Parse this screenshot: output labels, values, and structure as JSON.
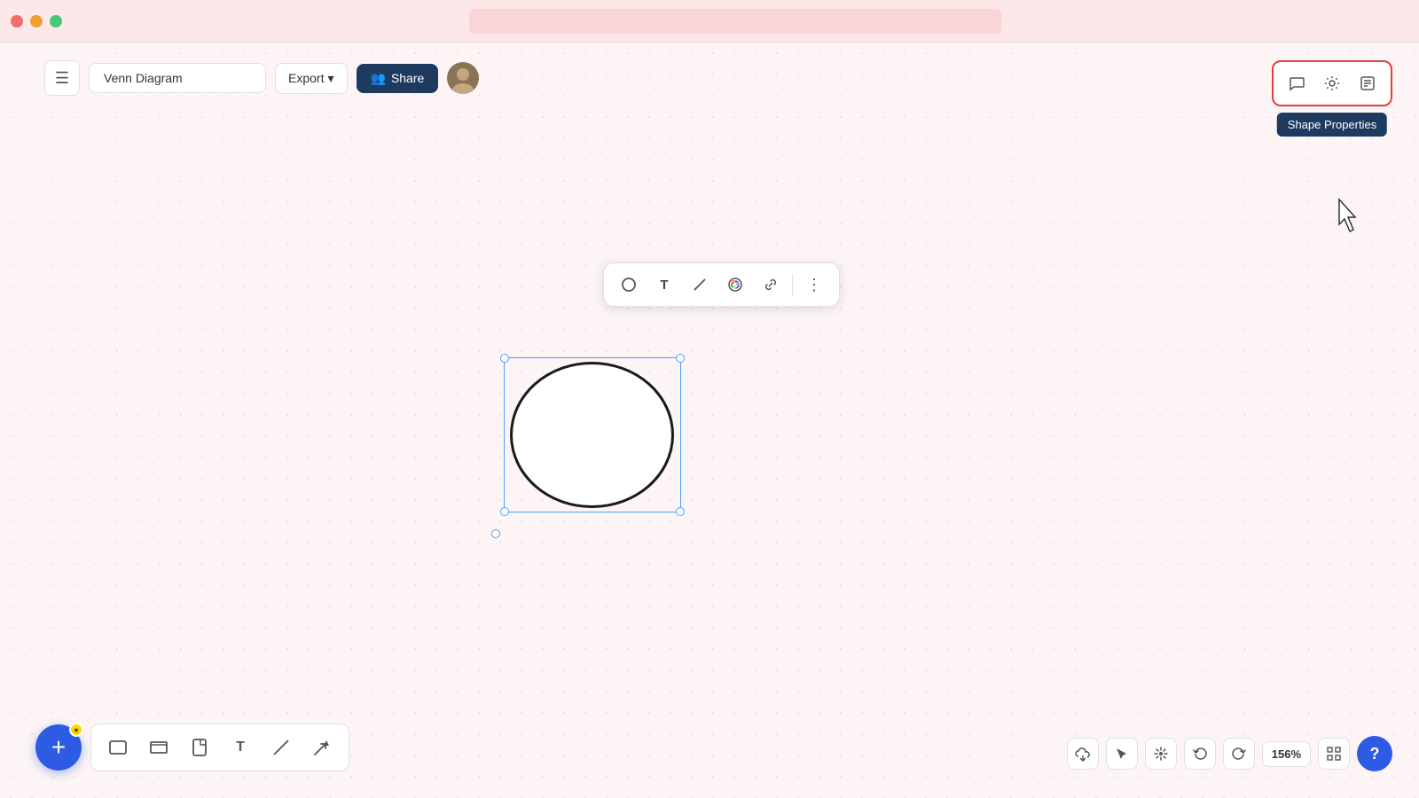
{
  "titleBar": {
    "dots": [
      "red",
      "yellow",
      "green"
    ]
  },
  "toolbar": {
    "menuIcon": "☰",
    "diagramTitle": "Venn Diagram",
    "exportLabel": "Export",
    "exportChevron": "▾",
    "shareIcon": "👥",
    "shareLabel": "Share"
  },
  "rightPanel": {
    "commentIcon": "💬",
    "settingsIcon": "⚙",
    "editIcon": "📝",
    "shapePropertiesLabel": "Shape Properties"
  },
  "shapeToolbar": {
    "circleIcon": "○",
    "textIcon": "T",
    "penIcon": "╱",
    "colorIcon": "◎",
    "linkIcon": "⛓",
    "moreIcon": "⋮"
  },
  "bottomToolbar": {
    "addIcon": "+",
    "rectangleIcon": "□",
    "frameIcon": "▭",
    "pageIcon": "◱",
    "textIcon": "T",
    "lineIcon": "╱",
    "arrowIcon": "➤"
  },
  "bottomRight": {
    "cloudIcon": "☁",
    "cursorIcon": "↖",
    "moveIcon": "✛",
    "undoIcon": "↩",
    "redoIcon": "↪",
    "zoomLevel": "156%",
    "gridIcon": "⊞",
    "helpIcon": "?"
  }
}
